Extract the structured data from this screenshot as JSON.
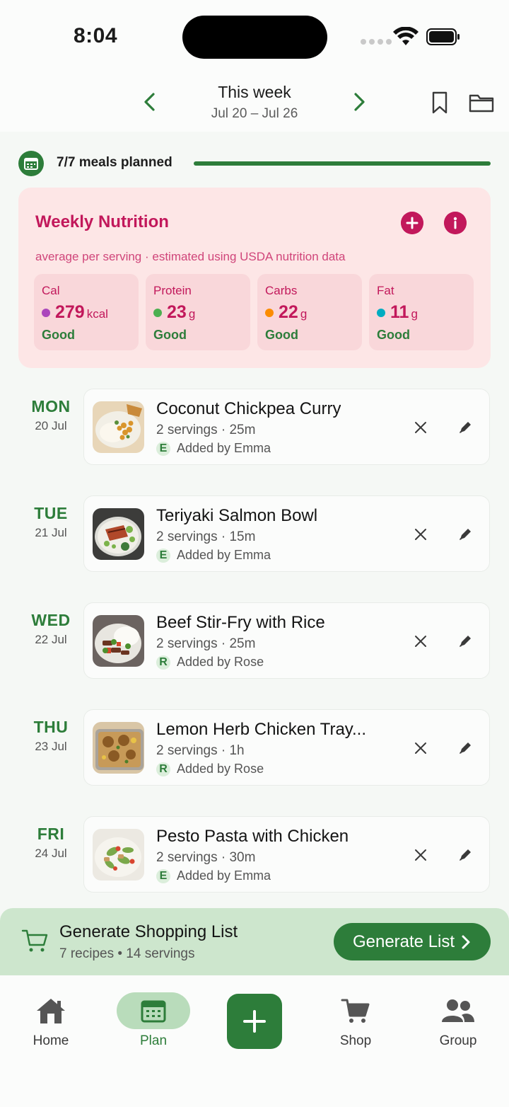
{
  "status": {
    "time": "8:04"
  },
  "header": {
    "title": "This week",
    "range": "Jul 20 – Jul 26"
  },
  "progress": {
    "label": "7/7 meals planned",
    "fraction": 1.0
  },
  "nutrition": {
    "title": "Weekly Nutrition",
    "subtitle": "average per serving · estimated using USDA nutrition data",
    "cells": [
      {
        "name": "Cal",
        "value": "279",
        "unit": "kcal",
        "status": "Good",
        "dot_color": "#ab47bc"
      },
      {
        "name": "Protein",
        "value": "23",
        "unit": "g",
        "status": "Good",
        "dot_color": "#4caf50"
      },
      {
        "name": "Carbs",
        "value": "22",
        "unit": "g",
        "status": "Good",
        "dot_color": "#fb8c00"
      },
      {
        "name": "Fat",
        "value": "11",
        "unit": "g",
        "status": "Good",
        "dot_color": "#00acc1"
      }
    ]
  },
  "meals": [
    {
      "day": "MON",
      "date": "20 Jul",
      "name": "Coconut Chickpea Curry",
      "meta": "2 servings · 25m",
      "initial": "E",
      "by": "Added by Emma"
    },
    {
      "day": "TUE",
      "date": "21 Jul",
      "name": "Teriyaki Salmon Bowl",
      "meta": "2 servings · 15m",
      "initial": "E",
      "by": "Added by Emma"
    },
    {
      "day": "WED",
      "date": "22 Jul",
      "name": "Beef Stir-Fry with Rice",
      "meta": "2 servings · 25m",
      "initial": "R",
      "by": "Added by Rose"
    },
    {
      "day": "THU",
      "date": "23 Jul",
      "name": "Lemon Herb Chicken Tray...",
      "meta": "2 servings · 1h",
      "initial": "R",
      "by": "Added by Rose"
    },
    {
      "day": "FRI",
      "date": "24 Jul",
      "name": "Pesto Pasta with Chicken",
      "meta": "2 servings · 30m",
      "initial": "E",
      "by": "Added by Emma"
    }
  ],
  "shopping": {
    "title": "Generate Shopping List",
    "subtitle": "7 recipes • 14 servings",
    "button": "Generate List"
  },
  "tabs": {
    "home": "Home",
    "plan": "Plan",
    "shop": "Shop",
    "group": "Group"
  },
  "colors": {
    "accent": "#2d7d3a",
    "nutrition_accent": "#c2185b"
  }
}
